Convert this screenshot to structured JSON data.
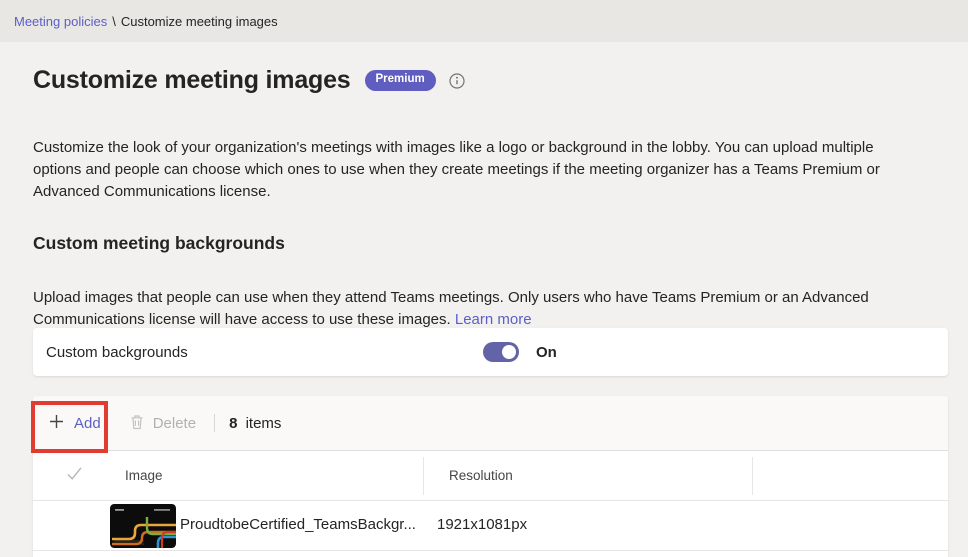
{
  "breadcrumb": {
    "parent": "Meeting policies",
    "separator": "\\",
    "current": "Customize meeting images"
  },
  "page": {
    "title": "Customize meeting images",
    "premium_badge": "Premium",
    "intro": "Customize the look of your organization's meetings with images like a logo or background in the lobby. You can upload multiple options and people can choose which ones to use when they create meetings if the meeting organizer has a Teams Premium or Advanced Communications license."
  },
  "backgrounds_section": {
    "heading": "Custom meeting backgrounds",
    "description": "Upload images that people can use when they attend Teams meetings. Only users who have Teams Premium or an Advanced Communications license will have access to use these images. ",
    "learn_more_label": "Learn more"
  },
  "toggle": {
    "label": "Custom backgrounds",
    "state": "On"
  },
  "toolbar": {
    "add_label": "Add",
    "delete_label": "Delete",
    "items_count": "8",
    "items_label": "items"
  },
  "table": {
    "columns": [
      "Image",
      "Resolution"
    ],
    "rows": [
      {
        "image_name": "ProudtobeCertified_TeamsBackgr...",
        "resolution": "1921x1081px"
      }
    ]
  },
  "icons": {
    "premium_info": "info-icon",
    "add": "plus-icon",
    "delete": "trash-icon",
    "select_all": "checkmark-icon"
  },
  "colors": {
    "accent_link": "#5b5fc7",
    "premium_badge_bg": "#5f5dc0",
    "toggle_on": "#6264a7",
    "annotation_red": "#e13c31"
  },
  "annotation": {
    "description": "red highlight box around Add button"
  }
}
